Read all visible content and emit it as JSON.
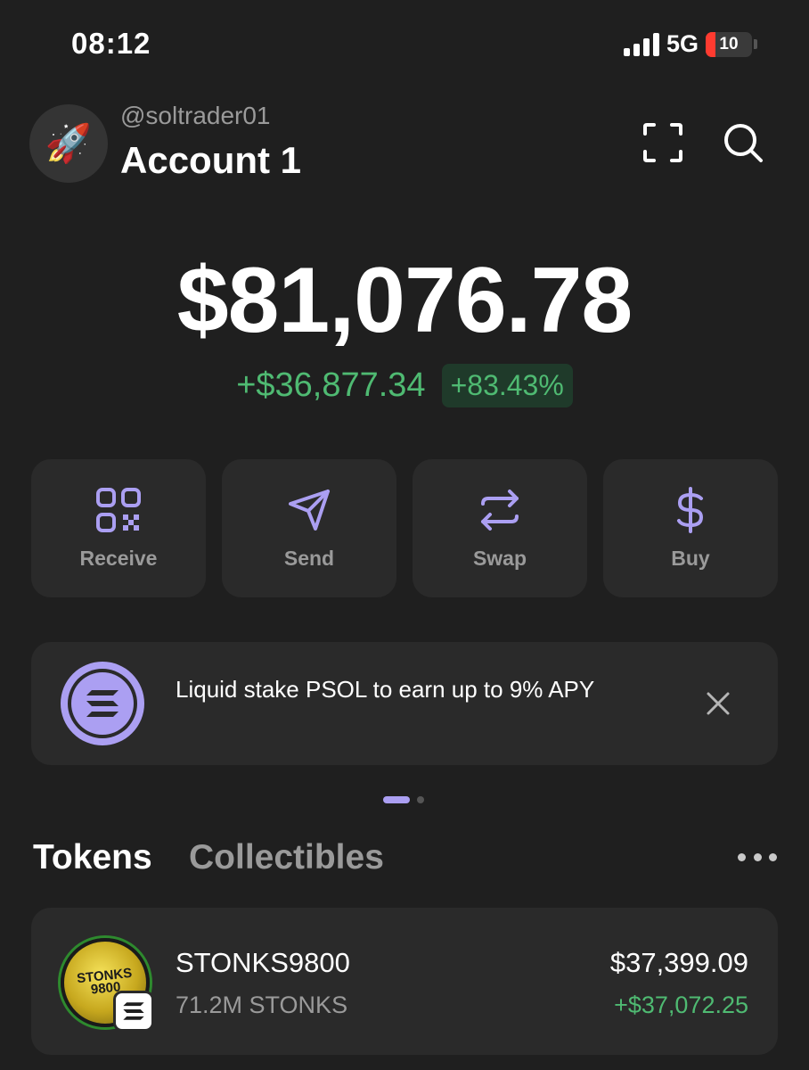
{
  "status_bar": {
    "time": "08:12",
    "network": "5G",
    "battery": "10"
  },
  "header": {
    "avatar_emoji": "🚀",
    "username": "@soltrader01",
    "account_name": "Account 1",
    "icons": [
      "scan-icon",
      "search-icon"
    ]
  },
  "balance": {
    "total": "$81,076.78",
    "change_abs": "+$36,877.34",
    "change_pct": "+83.43%"
  },
  "actions": [
    {
      "label": "Receive",
      "icon": "qr-code-icon"
    },
    {
      "label": "Send",
      "icon": "send-icon"
    },
    {
      "label": "Swap",
      "icon": "swap-icon"
    },
    {
      "label": "Buy",
      "icon": "dollar-icon"
    }
  ],
  "promo": {
    "text": "Liquid stake PSOL to earn up to 9% APY",
    "icon": "solana-logo-icon"
  },
  "pager": {
    "current": 1,
    "total": 2
  },
  "tabs": {
    "tokens": "Tokens",
    "collectibles": "Collectibles",
    "active": "Tokens"
  },
  "tokens": [
    {
      "name": "STONKS9800",
      "amount": "71.2M STONKS",
      "value": "$37,399.09",
      "change": "+$37,072.25",
      "logo_text": "STONKS 9800"
    }
  ],
  "colors": {
    "background": "#1f1f1f",
    "card": "#2a2a2a",
    "accent": "#ab9ff2",
    "positive": "#4fba72",
    "muted": "#9a9a9a"
  }
}
